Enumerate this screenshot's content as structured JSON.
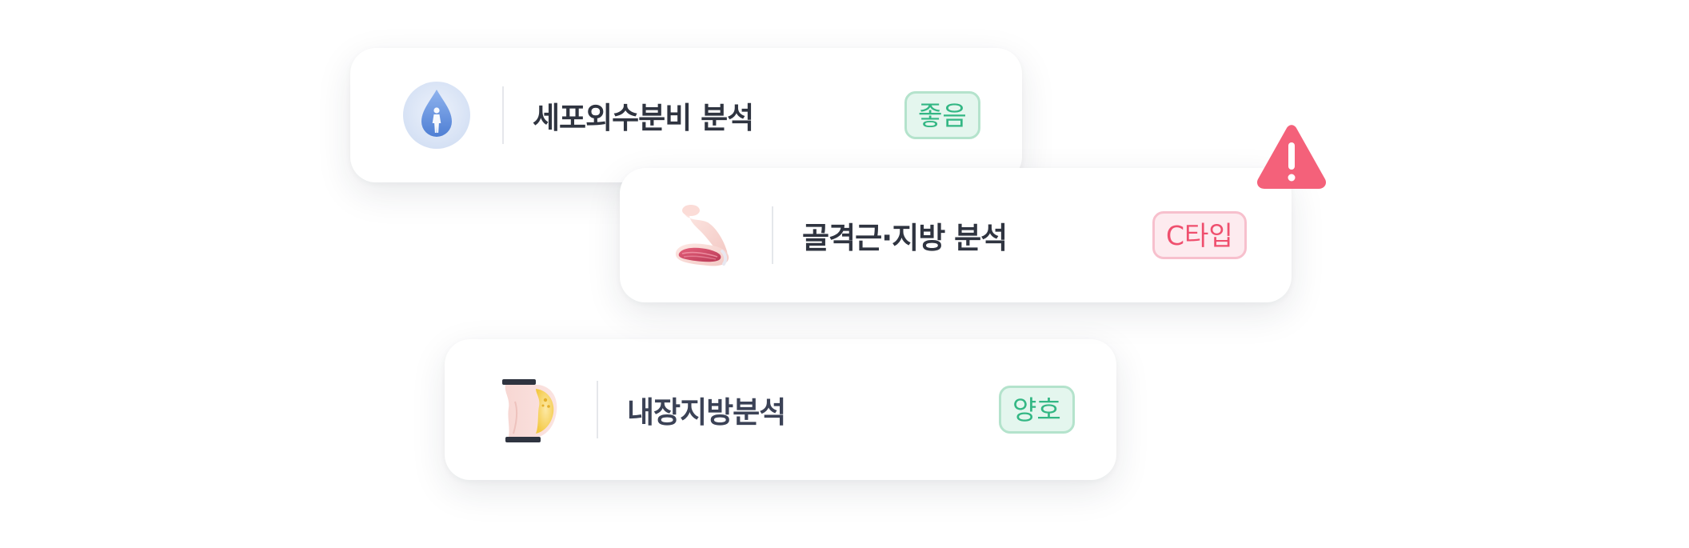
{
  "cards": [
    {
      "title": "세포외수분비 분석",
      "badge": "좋음",
      "badge_status": "good",
      "icon": "water-drop-body-icon"
    },
    {
      "title": "골격근·지방 분석",
      "badge": "C타입",
      "badge_status": "warning",
      "icon": "arm-muscle-icon"
    },
    {
      "title": "내장지방분석",
      "badge": "양호",
      "badge_status": "good",
      "icon": "visceral-fat-icon"
    }
  ],
  "alert_icon": "warning-triangle-icon",
  "colors": {
    "good_text": "#33b784",
    "good_bg": "#e4f6ee",
    "warn_text": "#ef4f6e",
    "warn_bg": "#fdebef",
    "alert": "#f4617a",
    "title_text": "#2f3440"
  }
}
